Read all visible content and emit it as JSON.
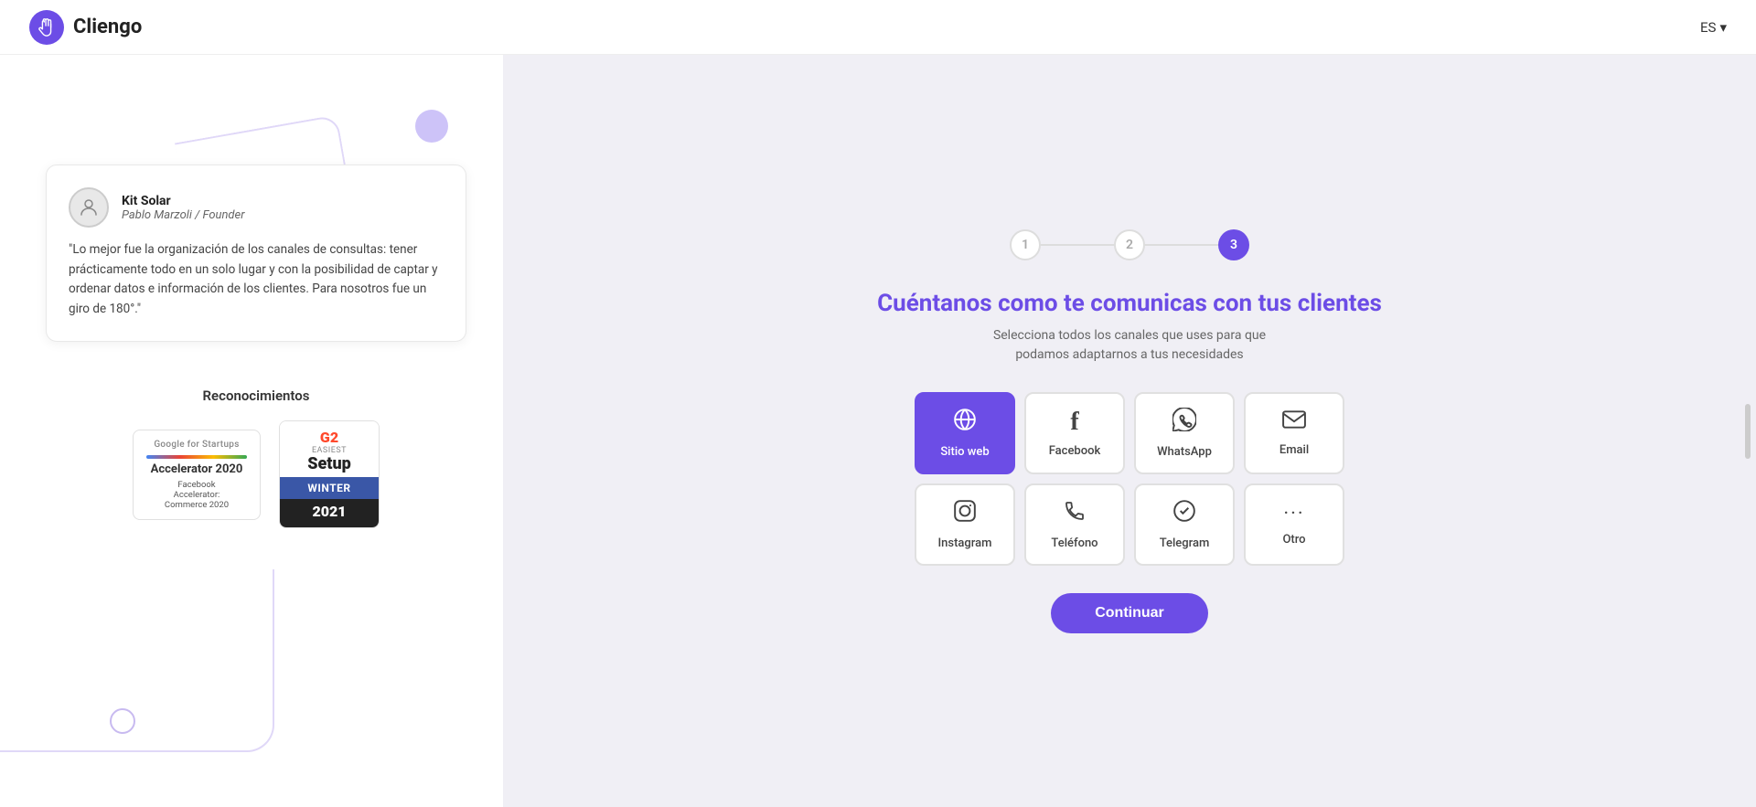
{
  "header": {
    "logo_text": "Cliengo",
    "lang": "ES",
    "lang_arrow": "▾"
  },
  "left_panel": {
    "testimonial": {
      "author_name": "Kit Solar",
      "author_role": "Pablo Marzoli / Founder",
      "quote": "\"Lo mejor fue la organización de los canales de consultas: tener prácticamente todo en un solo lugar y con la posibilidad de captar y ordenar datos e información de los clientes. Para nosotros fue un giro de 180°.\""
    },
    "recognitions_title": "Reconocimientos",
    "badge_google_line1": "Google for Startups",
    "badge_google_title": "Accelerator 2020",
    "badge_google_sub_line1": "Facebook",
    "badge_google_sub_line2": "Accelerator:",
    "badge_google_sub_line3": "Commerce 2020",
    "badge_g2_logo": "G2",
    "badge_g2_label": "Easiest",
    "badge_g2_main": "Setup",
    "badge_g2_bottom": "WINTER",
    "badge_g2_year": "2021"
  },
  "right_panel": {
    "steps": [
      {
        "number": "1",
        "state": "inactive"
      },
      {
        "number": "2",
        "state": "inactive"
      },
      {
        "number": "3",
        "state": "active"
      }
    ],
    "heading": "Cuéntanos como te comunicas con tus clientes",
    "subheading_line1": "Selecciona todos los canales que uses para que",
    "subheading_line2": "podamos adaptarnos a tus necesidades",
    "channels": [
      {
        "id": "sitio-web",
        "label": "Sitio web",
        "icon": "🌐",
        "selected": true
      },
      {
        "id": "facebook",
        "label": "Facebook",
        "icon": "f",
        "selected": false
      },
      {
        "id": "whatsapp",
        "label": "WhatsApp",
        "icon": "whatsapp",
        "selected": false
      },
      {
        "id": "email",
        "label": "Email",
        "icon": "email",
        "selected": false
      },
      {
        "id": "instagram",
        "label": "Instagram",
        "icon": "instagram",
        "selected": false
      },
      {
        "id": "telefono",
        "label": "Teléfono",
        "icon": "phone",
        "selected": false
      },
      {
        "id": "telegram",
        "label": "Telegram",
        "icon": "telegram",
        "selected": false
      },
      {
        "id": "otro",
        "label": "Otro",
        "icon": "more",
        "selected": false
      }
    ],
    "continue_label": "Continuar"
  }
}
